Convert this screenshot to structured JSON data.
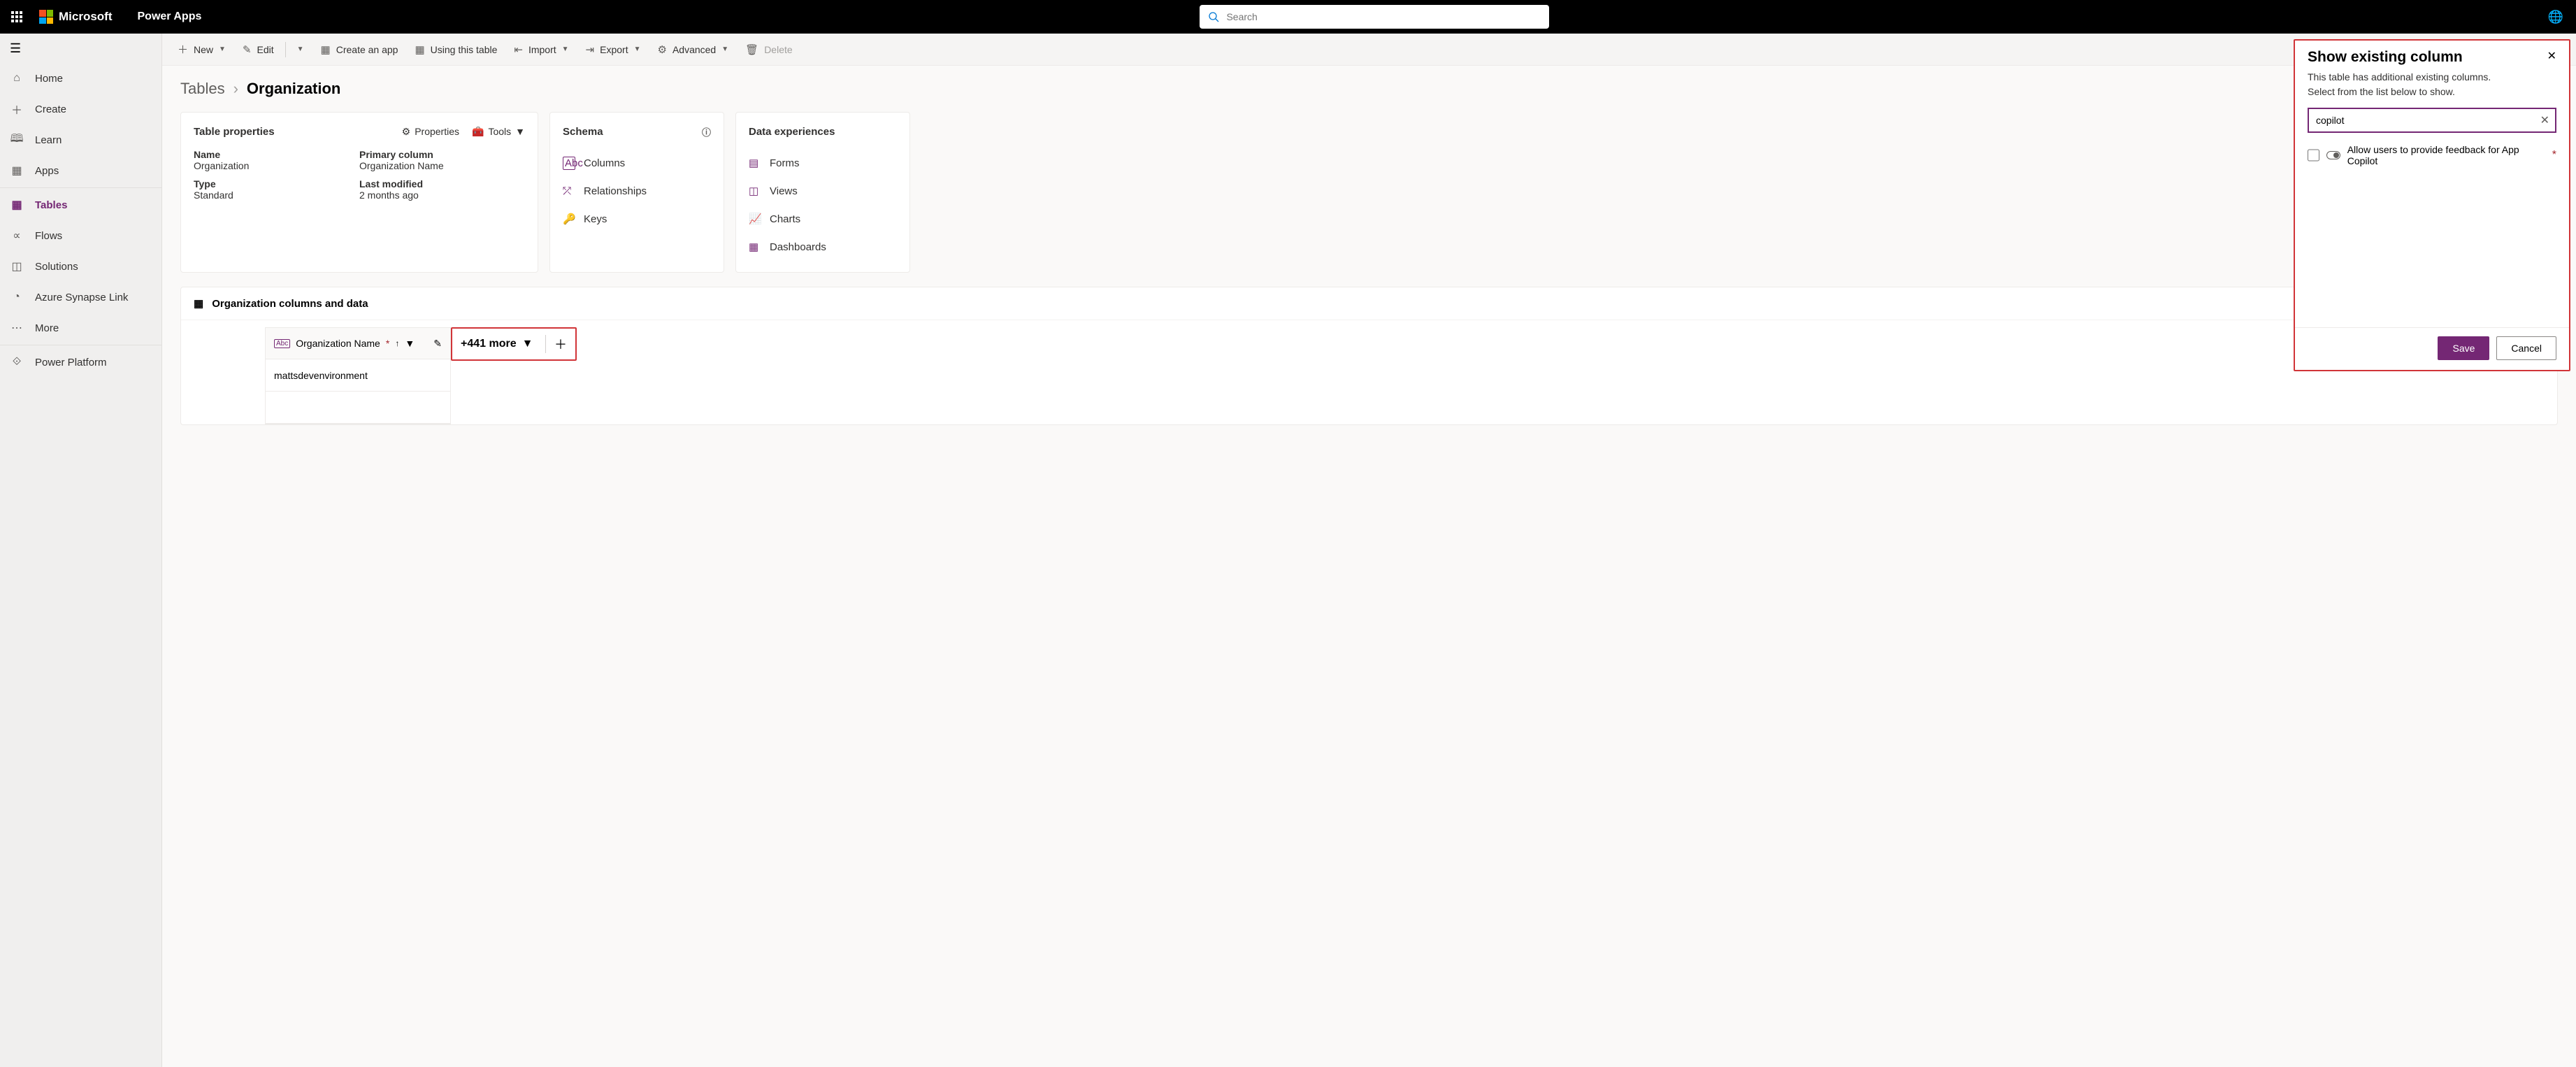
{
  "header": {
    "ms_name": "Microsoft",
    "app_name": "Power Apps",
    "search_placeholder": "Search"
  },
  "sidebar": {
    "items": [
      {
        "label": "Home",
        "icon": "home"
      },
      {
        "label": "Create",
        "icon": "plus"
      },
      {
        "label": "Learn",
        "icon": "book"
      },
      {
        "label": "Apps",
        "icon": "apps"
      },
      {
        "label": "Tables",
        "icon": "grid",
        "selected": true
      },
      {
        "label": "Flows",
        "icon": "flow"
      },
      {
        "label": "Solutions",
        "icon": "solutions"
      },
      {
        "label": "Azure Synapse Link",
        "icon": "synapse"
      },
      {
        "label": "More",
        "icon": "more"
      },
      {
        "label": "Power Platform",
        "icon": "pp"
      }
    ]
  },
  "cmdbar": {
    "new": "New",
    "edit": "Edit",
    "create_app": "Create an app",
    "using_table": "Using this table",
    "import": "Import",
    "export": "Export",
    "advanced": "Advanced",
    "delete": "Delete"
  },
  "breadcrumb": {
    "root": "Tables",
    "current": "Organization"
  },
  "props_card": {
    "title": "Table properties",
    "properties_link": "Properties",
    "tools_link": "Tools",
    "rows": {
      "name_label": "Name",
      "name_value": "Organization",
      "primary_label": "Primary column",
      "primary_value": "Organization Name",
      "type_label": "Type",
      "type_value": "Standard",
      "modified_label": "Last modified",
      "modified_value": "2 months ago"
    }
  },
  "schema_card": {
    "title": "Schema",
    "items": [
      "Columns",
      "Relationships",
      "Keys"
    ]
  },
  "dataexp_card": {
    "title": "Data experiences",
    "items": [
      "Forms",
      "Views",
      "Charts",
      "Dashboards"
    ]
  },
  "coldata": {
    "title": "Organization columns and data",
    "col_header": "Organization Name",
    "more_label": "+441 more",
    "row_value": "mattsdevenvironment"
  },
  "panel": {
    "title": "Show existing column",
    "subtitle1": "This table has additional existing columns.",
    "subtitle2": "Select from the list below to show.",
    "search_value": "copilot",
    "option_label": "Allow users to provide feedback for App Copilot",
    "save": "Save",
    "cancel": "Cancel"
  }
}
